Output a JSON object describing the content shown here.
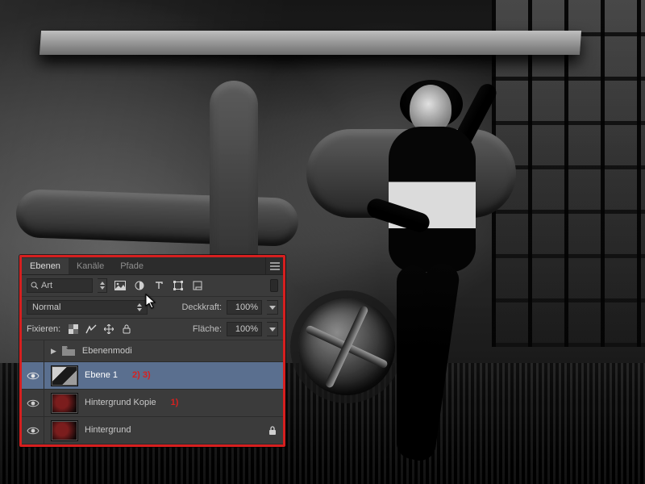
{
  "panel": {
    "tabs": {
      "layers": "Ebenen",
      "channels": "Kanäle",
      "paths": "Pfade"
    },
    "filter": {
      "kind": "Art"
    },
    "blend": {
      "mode": "Normal",
      "opacity_label": "Deckkraft:",
      "opacity_value": "100%"
    },
    "lock": {
      "label": "Fixieren:",
      "fill_label": "Fläche:",
      "fill_value": "100%"
    },
    "layers": [
      {
        "name": "Ebenenmodi"
      },
      {
        "name": "Ebene 1",
        "annotation": "2) 3)"
      },
      {
        "name": "Hintergrund Kopie",
        "annotation": "1)"
      },
      {
        "name": "Hintergrund"
      }
    ]
  },
  "colors": {
    "highlight_red": "#d61f1f",
    "selection_blue": "#5a6f8f"
  }
}
